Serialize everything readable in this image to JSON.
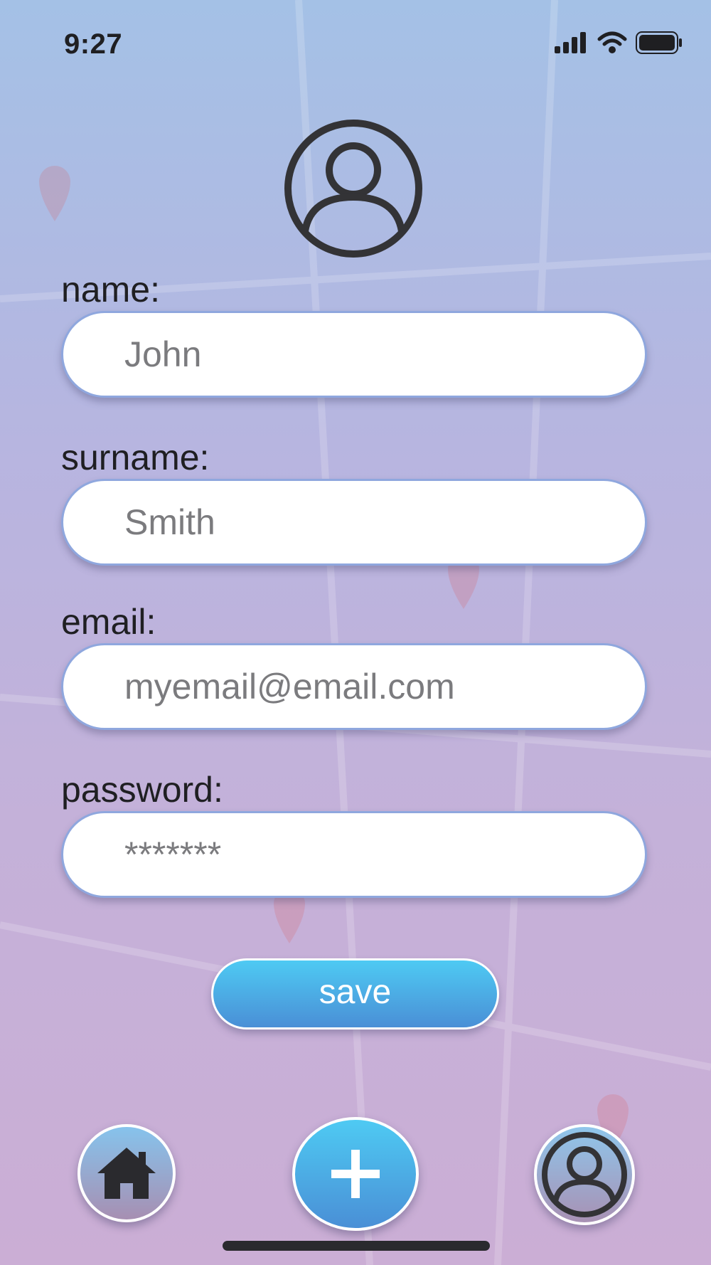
{
  "status_bar": {
    "time": "9:27",
    "icons": [
      "signal-icon",
      "wifi-icon",
      "battery-icon"
    ]
  },
  "profile": {
    "avatar_icon": "user-circle-icon"
  },
  "form": {
    "name": {
      "label": "name:",
      "value": "John"
    },
    "surname": {
      "label": "surname:",
      "value": "Smith"
    },
    "email": {
      "label": "email:",
      "value": "myemail@email.com"
    },
    "password": {
      "label": "password:",
      "value": "*******"
    }
  },
  "save_button": {
    "label": "save"
  },
  "bottom_nav": {
    "items": [
      {
        "icon": "home-icon"
      },
      {
        "icon": "plus-icon"
      },
      {
        "icon": "user-circle-icon"
      }
    ]
  },
  "colors": {
    "accent_gradient_top": "#4ecaf3",
    "accent_gradient_bottom": "#4a8fd6",
    "text_dark": "#1f1f22",
    "input_text": "#7b7b7e"
  }
}
